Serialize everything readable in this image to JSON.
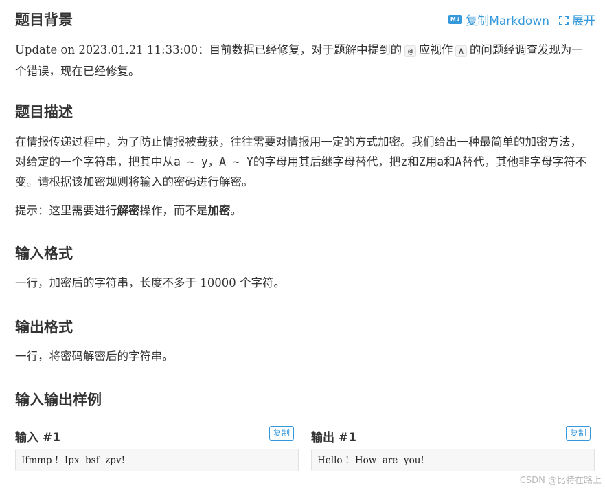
{
  "actions": {
    "copy_markdown": "复制Markdown",
    "expand": "展开"
  },
  "sections": {
    "background": {
      "title": "题目背景",
      "text_a": "Update on 2023.01.21 11:33:00：目前数据已经修复，对于题解中提到的",
      "code_at": "@",
      "text_b": "应视作",
      "code_a": "A",
      "text_c": "的问题经调查发现为一个错误，现在已经修复。"
    },
    "description": {
      "title": "题目描述",
      "p1_a": "在情报传递过程中，为了防止情报被截获，往往需要对情报用一定的方式加密。我们给出一种最简单的加密方法，对给定的一个字符串，把其中从",
      "p1_b": "a ∼ y",
      "p1_c": "，",
      "p1_d": "A ∼ Y",
      "p1_e": "的字母用其后继字母替代，把",
      "p1_f": "z",
      "p1_g": "和",
      "p1_h": "Z",
      "p1_i": "用",
      "p1_j": "a",
      "p1_k": "和",
      "p1_l": "A",
      "p1_m": "替代，其他非字母字符不变。请根据该加密规则将输入的密码进行解密。",
      "hint_a": "提示：这里需要进行",
      "hint_b": "解密",
      "hint_c": "操作，而不是",
      "hint_d": "加密",
      "hint_e": "。"
    },
    "input_format": {
      "title": "输入格式",
      "text_a": "一行，加密后的字符串，长度不多于",
      "num": "10000",
      "text_b": "个字符。"
    },
    "output_format": {
      "title": "输出格式",
      "text": "一行，将密码解密后的字符串。"
    },
    "samples": {
      "title": "输入输出样例",
      "input_label": "输入 #1",
      "output_label": "输出 #1",
      "copy": "复制",
      "input_value": "Ifmmp !  Ipx  bsf  zpv!",
      "output_value": "Hello !  How  are  you!"
    }
  },
  "watermark": "CSDN @比特在路上",
  "colors": {
    "accent": "#3498db",
    "text": "#333333"
  }
}
